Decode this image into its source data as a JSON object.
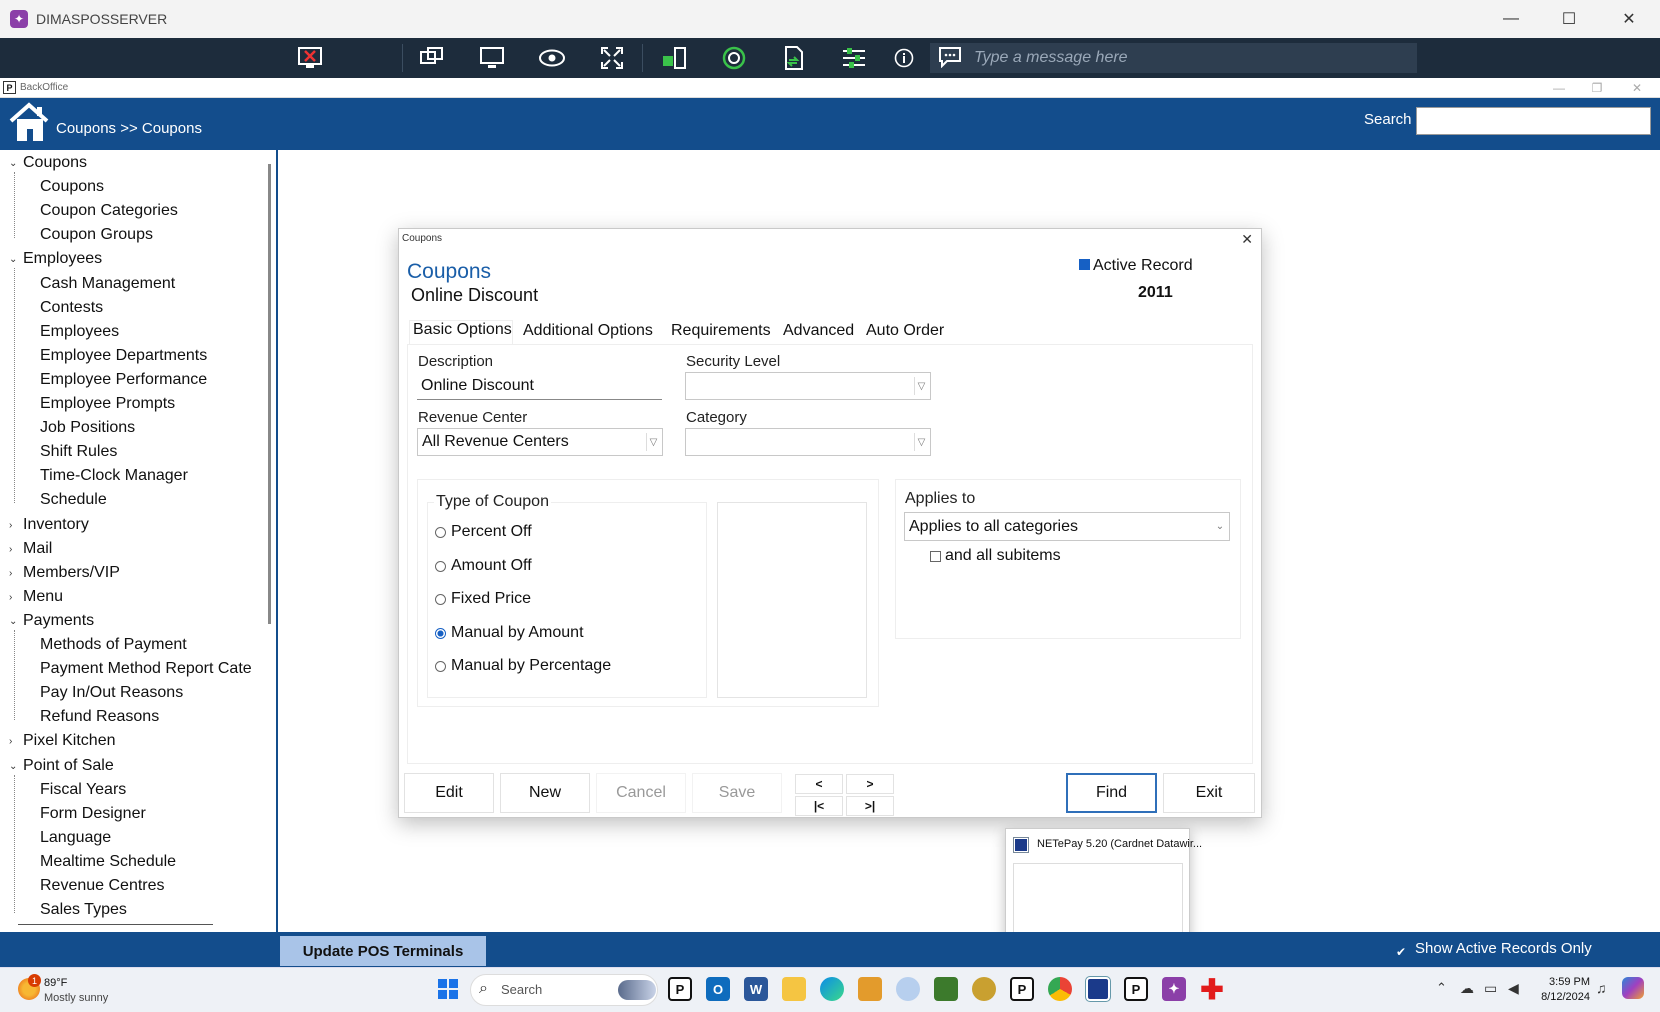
{
  "window": {
    "title": "DIMASPOSSERVER",
    "minimize": "—",
    "maximize": "☐",
    "close": "✕"
  },
  "remote_toolbar": {
    "message_placeholder": "Type a message here"
  },
  "backoffice": {
    "title": "BackOffice"
  },
  "header": {
    "breadcrumb": "Coupons >> Coupons",
    "search_label": "Search",
    "search_value": ""
  },
  "sidebar": {
    "groups": [
      {
        "label": "Coupons",
        "expanded": true,
        "children": [
          "Coupons",
          "Coupon Categories",
          "Coupon Groups"
        ]
      },
      {
        "label": "Employees",
        "expanded": true,
        "children": [
          "Cash Management",
          "Contests",
          "Employees",
          "Employee Departments",
          "Employee Performance",
          "Employee Prompts",
          "Job Positions",
          "Shift Rules",
          "Time-Clock Manager",
          "Schedule"
        ]
      },
      {
        "label": "Inventory",
        "expanded": false,
        "children": []
      },
      {
        "label": "Mail",
        "expanded": false,
        "children": []
      },
      {
        "label": "Members/VIP",
        "expanded": false,
        "children": []
      },
      {
        "label": "Menu",
        "expanded": false,
        "children": []
      },
      {
        "label": "Payments",
        "expanded": true,
        "children": [
          "Methods of Payment",
          "Payment Method Report Cate",
          "Pay In/Out Reasons",
          "Refund Reasons"
        ]
      },
      {
        "label": "Pixel Kitchen",
        "expanded": false,
        "children": []
      },
      {
        "label": "Point of Sale",
        "expanded": true,
        "children": [
          "Fiscal Years",
          "Form Designer",
          "Language",
          "Mealtime Schedule",
          "Revenue Centres",
          "Sales Types"
        ]
      }
    ]
  },
  "dialog": {
    "window_title": "Coupons",
    "heading": "Coupons",
    "record_name": "Online Discount",
    "active_record_label": "Active Record",
    "active_record_checked": true,
    "record_id": "2011",
    "tabs": [
      "Basic Options",
      "Additional Options",
      "Requirements",
      "Advanced",
      "Auto Order"
    ],
    "description_label": "Description",
    "description_value": "Online Discount",
    "security_label": "Security Level",
    "security_value": "",
    "revenue_label": "Revenue Center",
    "revenue_value": "All Revenue Centers",
    "category_label": "Category",
    "category_value": "",
    "type_label": "Type of Coupon",
    "types": [
      "Percent Off",
      "Amount Off",
      "Fixed Price",
      "Manual by Amount",
      "Manual by Percentage"
    ],
    "selected_type": "Manual by Amount",
    "applies_label": "Applies to",
    "applies_value": "Applies to all categories",
    "subitems_label": "and all subitems",
    "subitems_checked": false,
    "buttons": {
      "edit": "Edit",
      "new": "New",
      "cancel": "Cancel",
      "save": "Save",
      "prev": "<",
      "next": ">",
      "first": "|<",
      "last": ">|",
      "find": "Find",
      "exit": "Exit"
    }
  },
  "preview": {
    "title": "NETePay 5.20 (Cardnet Datawir..."
  },
  "footer": {
    "update_button": "Update POS Terminals",
    "show_active": "Show Active Records Only"
  },
  "taskbar": {
    "temp": "89°F",
    "weather": "Mostly sunny",
    "search": "Search",
    "time": "3:59 PM",
    "date": "8/12/2024",
    "badge": "1"
  },
  "colors": {
    "header": "#134d8c",
    "toolbar": "#1d2c3c",
    "accent": "#1660c4"
  }
}
